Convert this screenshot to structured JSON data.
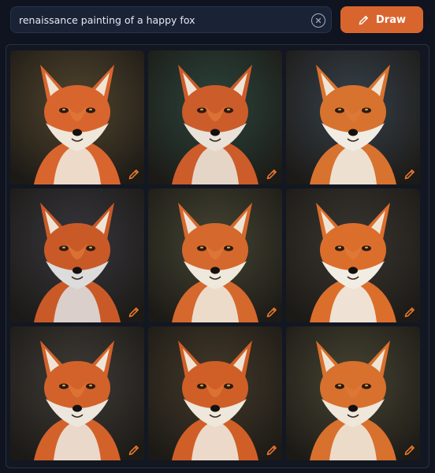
{
  "search": {
    "query": "renaissance painting of a happy fox",
    "clear_icon": "circle-x-icon"
  },
  "draw_button": {
    "label": "Draw",
    "icon": "pencil-icon",
    "color": "#d9652e"
  },
  "results": {
    "edit_icon": "pencil-icon",
    "accent_color": "#e8772e",
    "images": [
      {
        "bg": "#5a4a2e",
        "fur": "#d9652e",
        "cheek": "#efe7da"
      },
      {
        "bg": "#2f4a3e",
        "fur": "#cc5c2a",
        "cheek": "#e8e2d8"
      },
      {
        "bg": "#3b4650",
        "fur": "#d8722f",
        "cheek": "#f0ece3"
      },
      {
        "bg": "#3c3a40",
        "fur": "#c95a28",
        "cheek": "#dcdcdc"
      },
      {
        "bg": "#4b4a34",
        "fur": "#d5682c",
        "cheek": "#efe8dc"
      },
      {
        "bg": "#3f3a33",
        "fur": "#dc6e2c",
        "cheek": "#f1ede5"
      },
      {
        "bg": "#45403a",
        "fur": "#d2622a",
        "cheek": "#ece6dc"
      },
      {
        "bg": "#4a3d2a",
        "fur": "#cf5f27",
        "cheek": "#eee7dc"
      },
      {
        "bg": "#4e4a34",
        "fur": "#d8702e",
        "cheek": "#efe7da"
      }
    ]
  }
}
